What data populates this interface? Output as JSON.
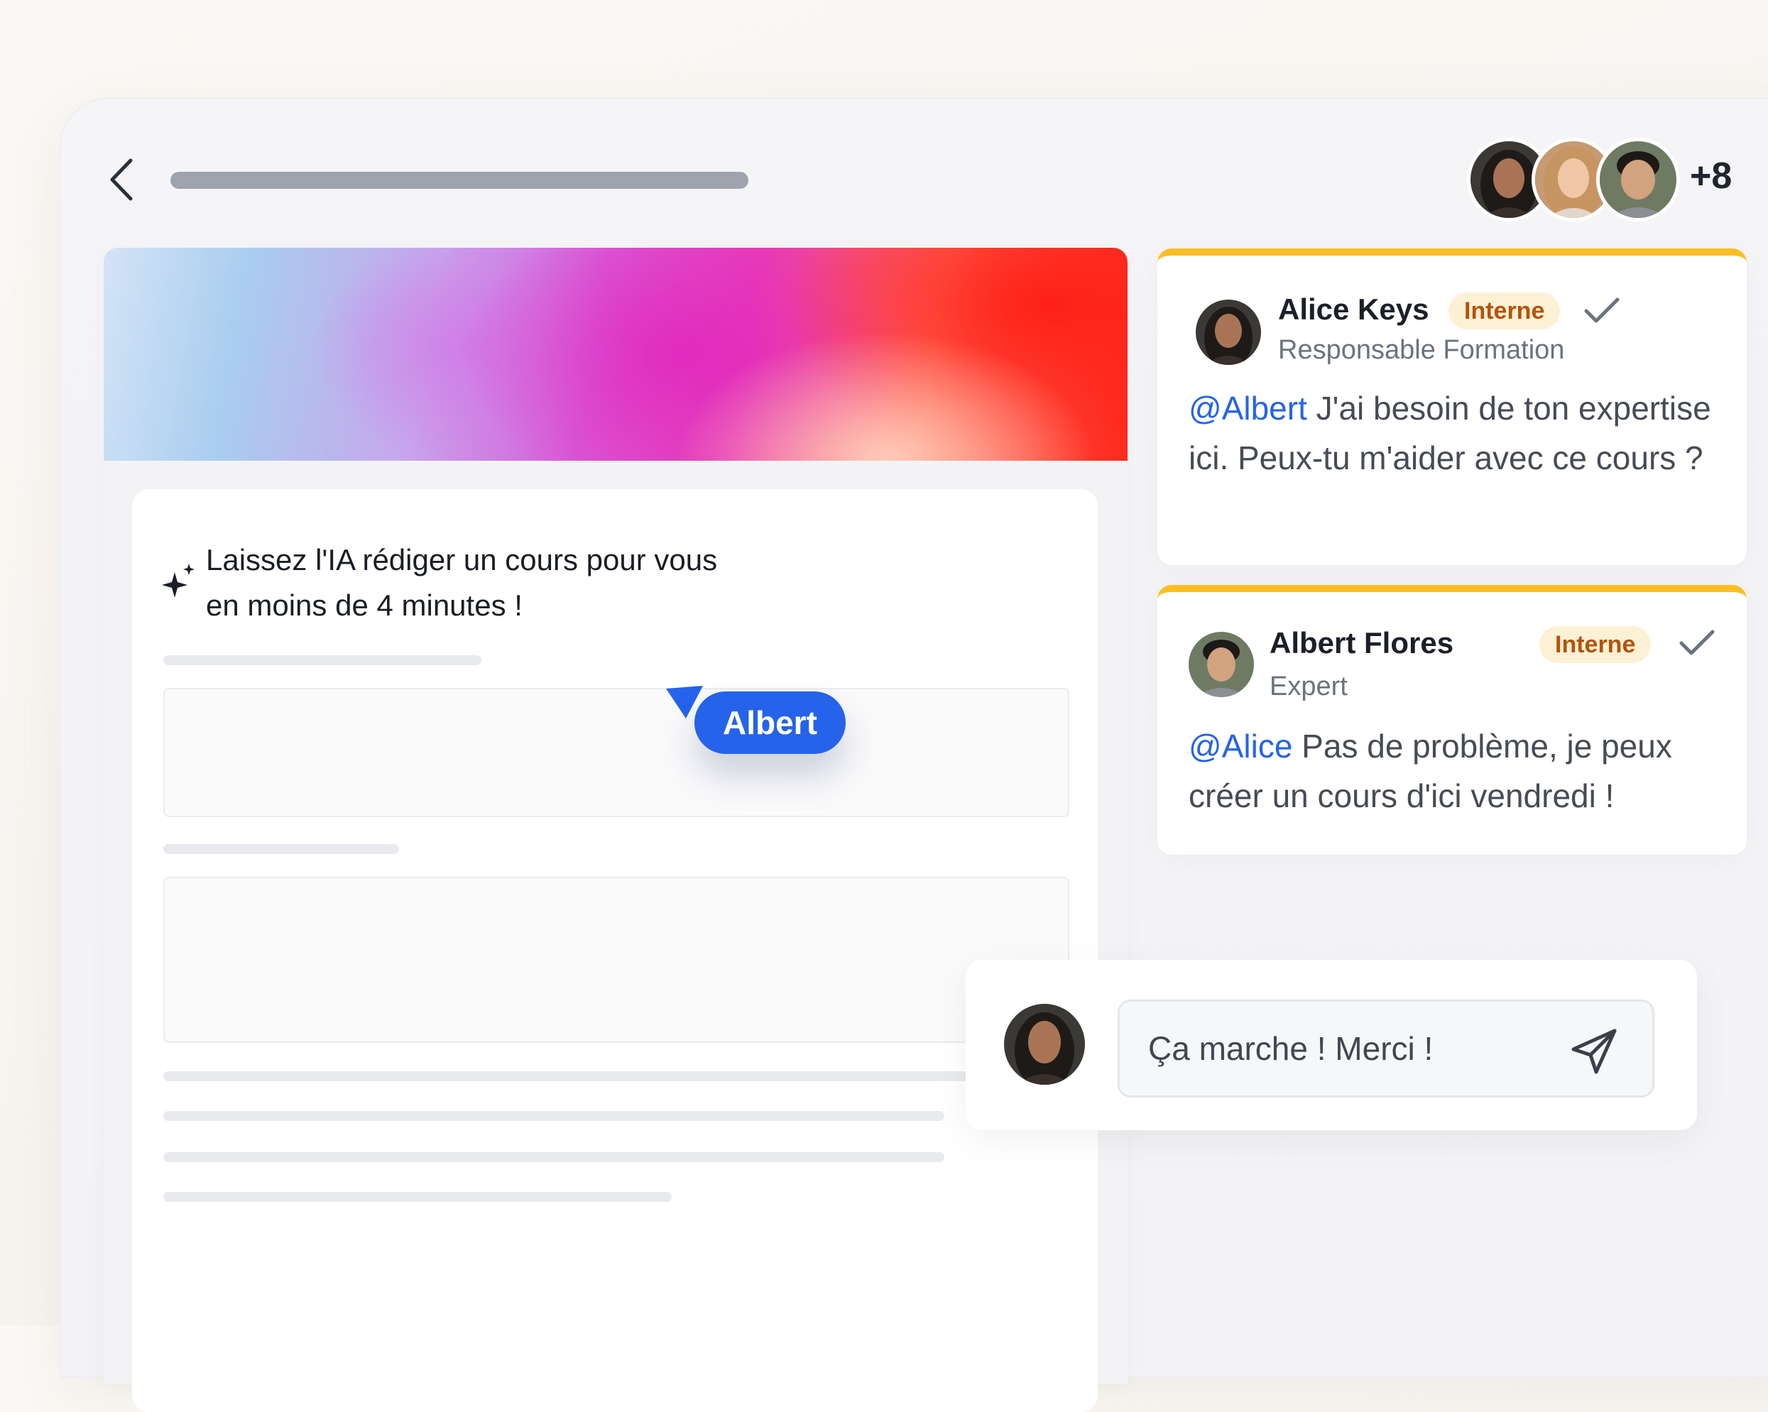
{
  "header": {
    "back_icon": "chevron-left-icon",
    "participants_more": "+8"
  },
  "editor": {
    "prompt_line_1": "Laissez l'IA rédiger un cours pour vous",
    "prompt_line_2": "en moins de 4 minutes !",
    "sparkle_icon": "sparkle-icon",
    "cursor_label": "Albert",
    "cursor_color": "#2563eb"
  },
  "comments": [
    {
      "author": "Alice Keys",
      "badge": "Interne",
      "role": "Responsable Formation",
      "mention": "@Albert",
      "text": " J'ai besoin de ton expertise ici. Peux-tu m'aider avec ce cours ?"
    },
    {
      "author": "Albert Flores",
      "badge": "Interne",
      "role": "Expert",
      "mention": "@Alice",
      "text": " Pas de problème, je peux créer un cours d'ici vendredi !"
    }
  ],
  "reply": {
    "value": "Ça marche ! Merci !",
    "send_icon": "send-icon"
  },
  "colors": {
    "accent": "#2563eb",
    "card_border": "#fbbf24",
    "badge_bg": "#fdf1d5",
    "badge_text": "#b45309"
  }
}
